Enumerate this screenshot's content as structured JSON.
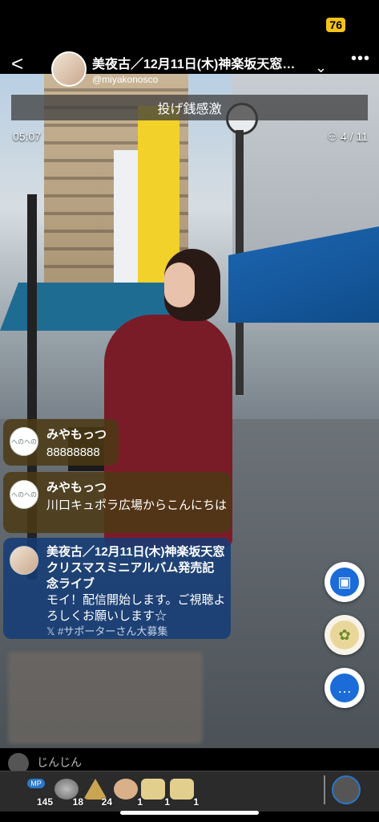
{
  "status": {
    "battery": "76"
  },
  "header": {
    "title": "美夜古／12月11日(木)神楽坂天窓…",
    "handle": "@miyakonosco",
    "chevron": "⌄",
    "more": "•••"
  },
  "gift_banner": "投げ銭感激",
  "stream": {
    "elapsed": "05:07",
    "viewers": "4 / 11"
  },
  "comments": [
    {
      "name": "みやもっつ",
      "text": "88888888",
      "avatar_label": "へのへの"
    },
    {
      "name": "みやもっつ",
      "text": "川口キュポラ広場からこんにちは",
      "avatar_label": "へのへの"
    },
    {
      "name": "美夜古／12月11日(木)神楽坂天窓クリスマスミニアルバム発売記念ライブ",
      "text": "モイ！配信開始します。ご視聴よろしくお願いします☆",
      "sub": "𝕏 #サポーターさん大募集"
    }
  ],
  "bottom": {
    "user_label": "じんじん",
    "items": [
      {
        "icon": "mp-badge-icon",
        "label": "MP",
        "count": "145"
      },
      {
        "icon": "coin-icon",
        "count": "18"
      },
      {
        "icon": "pyramid-icon",
        "count": "24"
      },
      {
        "icon": "clap-icon",
        "count": "1"
      },
      {
        "icon": "card-icon",
        "count": "1"
      },
      {
        "icon": "card-icon",
        "count": "1"
      }
    ]
  },
  "colors": {
    "accent": "#1b6bd8",
    "comment_bg": "#4b3a14",
    "owner_comment_bg": "#143c78"
  }
}
